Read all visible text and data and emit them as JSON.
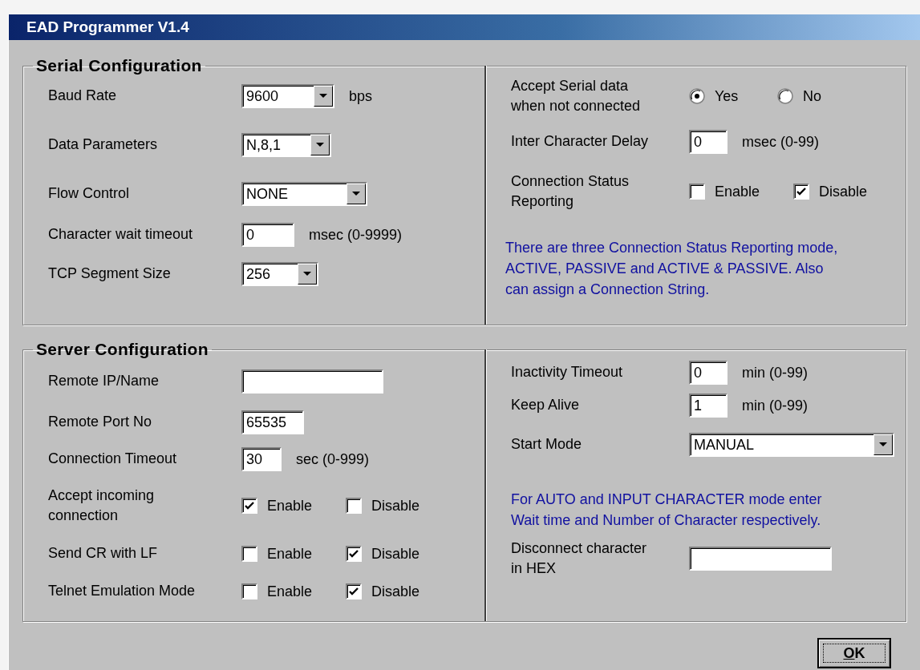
{
  "window": {
    "title": "EAD Programmer V1.4"
  },
  "serial": {
    "title": "Serial Configuration",
    "left": [
      {
        "kind": "dropdown",
        "label": "Baud Rate",
        "value": "9600",
        "unit": "bps"
      },
      {
        "kind": "dropdown",
        "label": "Data Parameters",
        "value": "N,8,1"
      },
      {
        "kind": "dropdown",
        "label": "Flow Control",
        "value": "NONE"
      },
      {
        "kind": "text",
        "label": "Character wait timeout",
        "value": "0",
        "unit": "msec (0-9999)"
      },
      {
        "kind": "dropdown",
        "label": "TCP Segment Size",
        "value": "256"
      }
    ],
    "right": [
      {
        "kind": "radio",
        "label": "Accept Serial data\nwhen not connected",
        "options": [
          {
            "label": "Yes",
            "selected": true
          },
          {
            "label": "No",
            "selected": false
          }
        ]
      },
      {
        "kind": "text",
        "label": "Inter Character Delay",
        "value": "0",
        "unit": "msec (0-99)"
      },
      {
        "kind": "checks",
        "label": "Connection Status\nReporting",
        "options": [
          {
            "label": "Enable",
            "checked": false
          },
          {
            "label": "Disable",
            "checked": true
          }
        ]
      }
    ],
    "note": "There are three Connection Status Reporting mode,\nACTIVE, PASSIVE and ACTIVE & PASSIVE. Also\ncan assign a Connection String."
  },
  "server": {
    "title": "Server Configuration",
    "left": [
      {
        "kind": "text",
        "label": "Remote IP/Name"
      },
      {
        "kind": "text",
        "label": "Remote Port No",
        "value": "65535"
      },
      {
        "kind": "text",
        "label": "Connection Timeout",
        "value": "30",
        "unit": "sec (0-999)"
      },
      {
        "kind": "checks",
        "label": "Accept incoming\nconnection",
        "options": [
          {
            "label": "Enable",
            "checked": true
          },
          {
            "label": "Disable",
            "checked": false
          }
        ]
      },
      {
        "kind": "checks",
        "label": "Send CR with LF",
        "options": [
          {
            "label": "Enable",
            "checked": false
          },
          {
            "label": "Disable",
            "checked": true
          }
        ]
      },
      {
        "kind": "checks",
        "label": "Telnet Emulation Mode",
        "options": [
          {
            "label": "Enable",
            "checked": false
          },
          {
            "label": "Disable",
            "checked": true
          }
        ]
      }
    ],
    "right": [
      {
        "kind": "text",
        "label": "Inactivity Timeout",
        "value": "0",
        "unit": "min (0-99)"
      },
      {
        "kind": "text",
        "label": "Keep Alive",
        "value": "1",
        "unit": "min (0-99)"
      },
      {
        "kind": "dropdown",
        "label": "Start Mode",
        "value": "MANUAL"
      }
    ],
    "note": "For AUTO and  INPUT CHARACTER mode enter\nWait time and Number of Character  respectively.",
    "after_note": [
      {
        "kind": "text",
        "label": "Disconnect character\nin  HEX"
      }
    ]
  },
  "ok_button": {
    "label": "OK"
  }
}
